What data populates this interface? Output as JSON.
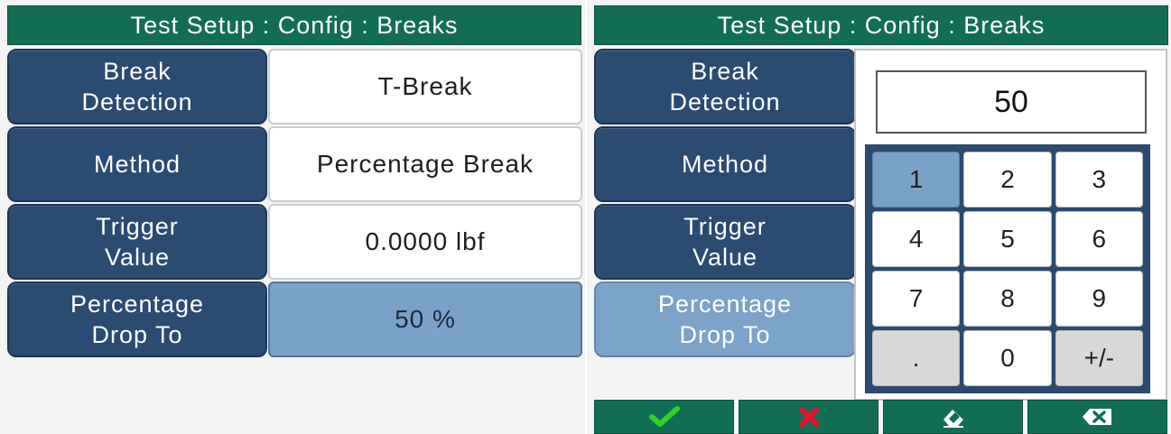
{
  "left": {
    "title": "Test Setup : Config : Breaks",
    "rows": [
      {
        "label": "Break\nDetection",
        "value": "T-Break"
      },
      {
        "label": "Method",
        "value": "Percentage Break"
      },
      {
        "label": "Trigger\nValue",
        "value": "0.0000 lbf"
      },
      {
        "label": "Percentage\nDrop To",
        "value": "50 %"
      }
    ]
  },
  "right": {
    "title": "Test Setup : Config : Breaks",
    "rows": [
      {
        "label": "Break\nDetection"
      },
      {
        "label": "Method"
      },
      {
        "label": "Trigger\nValue"
      },
      {
        "label": "Percentage\nDrop To"
      }
    ],
    "keypad": {
      "display": "50",
      "keys": [
        "1",
        "2",
        "3",
        "4",
        "5",
        "6",
        "7",
        "8",
        "9",
        ".",
        "0",
        "+/-"
      ]
    },
    "bottom_bar": {
      "confirm_icon": "check-icon",
      "cancel_icon": "x-icon",
      "clear_icon": "eraser-icon",
      "backspace_icon": "backspace-icon",
      "confirm_color": "#2fd11f",
      "cancel_color": "#e8102a"
    }
  },
  "colors": {
    "title_green": "#116e55",
    "label_blue": "#2a4b72",
    "selected_blue": "#7aa2c9"
  }
}
